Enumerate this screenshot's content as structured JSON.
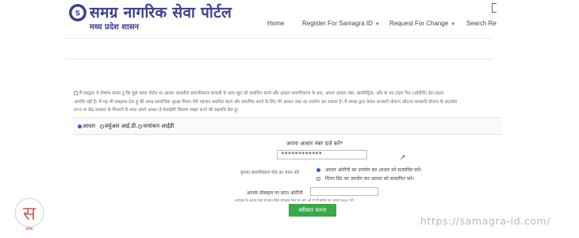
{
  "header": {
    "title": "समग्र नागरिक सेवा पोर्टल",
    "subtitle": "मध्य प्रदेश शासन",
    "nav": {
      "home": "Home",
      "register": "Register For Samagra ID",
      "request": "Request For Change",
      "search": "Search Re"
    }
  },
  "form": {
    "consent_lines": [
      "मैं एतद्वारा ये घोषणा करता हूं कि मुझे समग्र पोर्टल पर आधार आधारित प्रमाणीकरण प्रणाली के साथ खुद को प्रमाणित करने और आधार प्रमाणीकरण के बाद, अपना आधार नंबर, बायोमेट्रिक, और या वन टाइम पिन (ओटीपी) डेटा प्रदान",
      "आपत्ति नहीं है। मैं यह भी समझता देता हूं की समग्र सामाजिक सुरक्षा मिशन मेरी पहचान स्थापित करने और प्रमाणित करने के लिए मेरे आधार नंबर का उपयोग कर सकता है। मैं समझ द्वारा केवल सरकारी योजना और/या सरकारी योजना के डाटाबेस",
      "राज्य या केंद्र सरकार के विभागों के साथ अपने आधार ई-केवाईसी विवरण साझा करने की सहमति देता हूं।"
    ],
    "id_options": [
      "आधार",
      "वर्चुअल आई.डी.",
      "नामांकन आईडी"
    ],
    "aadhar_label": "अपना आधार नंबर दर्ज करें*",
    "aadhar_value": "************",
    "auth_label": "कृपया प्रमाणीकरण मोड का चयन करें",
    "auth_options": [
      "आधार ओटीपी का उपयोग कर आधार को सत्यापित करें।",
      "फिंगर प्रिंट का उपयोग कर आधार को सत्यापित करें।"
    ],
    "otp_label": "आपके मोबाइल पर प्राप्त ओटीपी",
    "otp_note": "आवेदक के आधार नंबर के साथ लिंक मोबाइल नंबर पर आए ओ टी पी प्रविष्ट कर आधार ekyc करे",
    "submit_label": "स्वीकार करना"
  },
  "watermark": {
    "logo_text": "समग्र",
    "url": "https://samagra-id.com/"
  },
  "colors": {
    "brand": "#3d3f8f",
    "submit": "#3aa84a",
    "watermark_red": "#c0392b"
  }
}
